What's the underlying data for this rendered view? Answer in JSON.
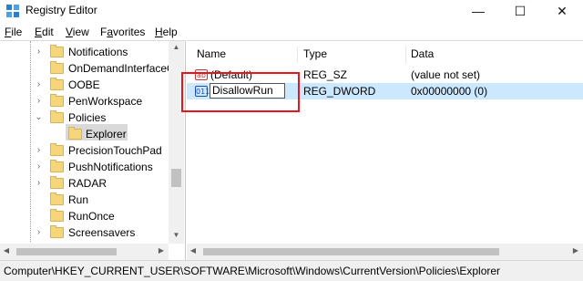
{
  "window": {
    "title": "Registry Editor",
    "minimize": "—",
    "maximize": "☐",
    "close": "✕"
  },
  "menu": [
    {
      "pre": "",
      "u": "F",
      "post": "ile"
    },
    {
      "pre": "",
      "u": "E",
      "post": "dit"
    },
    {
      "pre": "",
      "u": "V",
      "post": "iew"
    },
    {
      "pre": "F",
      "u": "a",
      "post": "vorites"
    },
    {
      "pre": "",
      "u": "H",
      "post": "elp"
    }
  ],
  "tree": {
    "nodes": [
      {
        "label": "Notifications",
        "expander": "›"
      },
      {
        "label": "OnDemandInterfaceC",
        "expander": ""
      },
      {
        "label": "OOBE",
        "expander": "›"
      },
      {
        "label": "PenWorkspace",
        "expander": "›"
      },
      {
        "label": "Policies",
        "expander": "⌄"
      },
      {
        "label": "Explorer",
        "expander": "",
        "child": true
      },
      {
        "label": "PrecisionTouchPad",
        "expander": "›"
      },
      {
        "label": "PushNotifications",
        "expander": "›"
      },
      {
        "label": "RADAR",
        "expander": "›"
      },
      {
        "label": "Run",
        "expander": ""
      },
      {
        "label": "RunOnce",
        "expander": ""
      },
      {
        "label": "Screensavers",
        "expander": "›"
      }
    ],
    "selected": "Explorer"
  },
  "list": {
    "headers": {
      "name": "Name",
      "type": "Type",
      "data": "Data"
    },
    "rows": [
      {
        "icon": "ab",
        "name": "(Default)",
        "type": "REG_SZ",
        "data": "(value not set)"
      },
      {
        "icon": "011",
        "name": "DisallowRun",
        "type": "REG_DWORD",
        "data": "0x00000000 (0)",
        "editing": true
      }
    ]
  },
  "status": {
    "path": "Computer\\HKEY_CURRENT_USER\\SOFTWARE\\Microsoft\\Windows\\CurrentVersion\\Policies\\Explorer"
  },
  "colors": {
    "selection": "#cce8ff",
    "highlight_box": "#e8151c",
    "folder": "#f5d67a"
  }
}
